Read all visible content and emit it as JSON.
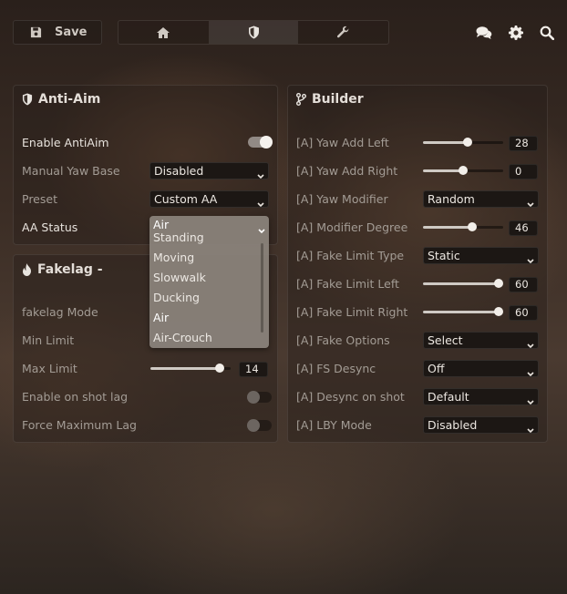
{
  "toolbar": {
    "save_label": "Save",
    "tabs": [
      {
        "name": "home",
        "icon": "home-icon",
        "active": false
      },
      {
        "name": "shield",
        "icon": "shield-icon",
        "active": true
      },
      {
        "name": "wrench",
        "icon": "wrench-icon",
        "active": false
      }
    ],
    "right_icons": [
      "chat-icon",
      "gear-icon",
      "search-icon"
    ]
  },
  "anti_aim": {
    "title": "Anti-Aim",
    "enable_label": "Enable AntiAim",
    "enable_on": true,
    "manual_yaw_label": "Manual Yaw Base",
    "manual_yaw_value": "Disabled",
    "preset_label": "Preset",
    "preset_value": "Custom AA",
    "aa_status_label": "AA Status",
    "aa_status_value": "Air",
    "aa_status_options": [
      "Standing",
      "Moving",
      "Slowwalk",
      "Ducking",
      "Air",
      "Air-Crouch"
    ]
  },
  "fakelag": {
    "title": "Fakelag -",
    "mode_label": "fakelag Mode",
    "min_label": "Min Limit",
    "max_label": "Max Limit",
    "max_value": "14",
    "max_fraction": 0.86,
    "onshot_label": "Enable on shot lag",
    "onshot_on": false,
    "force_label": "Force Maximum Lag",
    "force_on": false
  },
  "builder": {
    "title": "Builder",
    "yaw_left_label": "[A] Yaw Add Left",
    "yaw_left_value": "28",
    "yaw_left_fraction": 0.56,
    "yaw_right_label": "[A] Yaw Add Right",
    "yaw_right_value": "0",
    "yaw_right_fraction": 0.5,
    "modifier_label": "[A] Yaw Modifier",
    "modifier_value": "Random",
    "degree_label": "[A] Modifier Degree",
    "degree_value": "46",
    "degree_fraction": 0.61,
    "fake_type_label": "[A] Fake Limit Type",
    "fake_type_value": "Static",
    "fake_left_label": "[A] Fake Limit Left",
    "fake_left_value": "60",
    "fake_left_fraction": 1.0,
    "fake_right_label": "[A] Fake Limit Right",
    "fake_right_value": "60",
    "fake_right_fraction": 1.0,
    "fake_opts_label": "[A] Fake Options",
    "fake_opts_value": "Select",
    "fs_label": "[A] FS Desync",
    "fs_value": "Off",
    "onshot_label": "[A] Desync on shot",
    "onshot_value": "Default",
    "lby_label": "[A] LBY Mode",
    "lby_value": "Disabled"
  }
}
